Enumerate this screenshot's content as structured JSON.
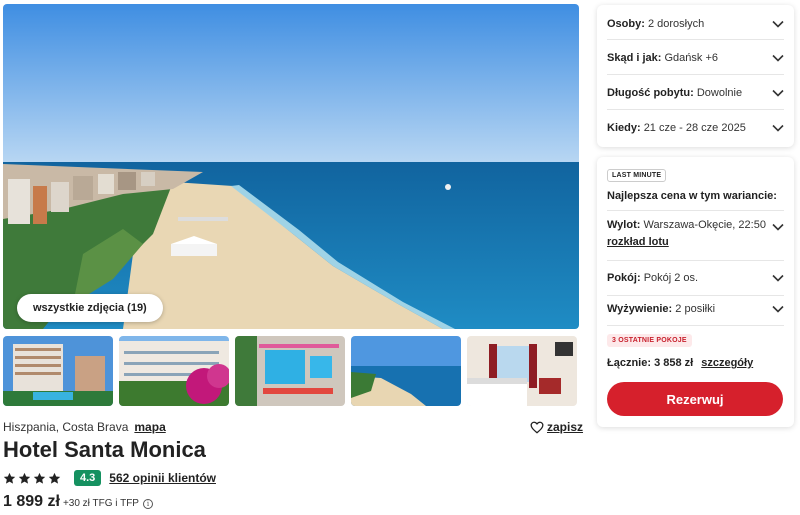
{
  "gallery": {
    "all_photos_label": "wszystkie zdjęcia (19)"
  },
  "hotel": {
    "location": "Hiszpania, Costa Brava",
    "map_link": "mapa",
    "save_label": "zapisz",
    "name": "Hotel Santa Monica",
    "stars": 4,
    "score": "4.3",
    "reviews_link": "562 opinii klientów",
    "price": "1 899 zł",
    "price_extra": "+30 zł TFG i TFP"
  },
  "search": {
    "travelers": {
      "label": "Osoby:",
      "value": "2 dorosłych"
    },
    "departure": {
      "label": "Skąd i jak:",
      "value": "Gdańsk +6"
    },
    "duration": {
      "label": "Długość pobytu:",
      "value": "Dowolnie"
    },
    "dates": {
      "label": "Kiedy:",
      "value": "21 cze - 28 cze 2025"
    }
  },
  "offer": {
    "badge": "LAST MINUTE",
    "best_price_label": "Najlepsza cena w tym wariancie:",
    "flight": {
      "label": "Wylot:",
      "value": "Warszawa-Okęcie, 22:50",
      "link": "rozkład lotu"
    },
    "room": {
      "label": "Pokój:",
      "value": "Pokój 2 os."
    },
    "board": {
      "label": "Wyżywienie:",
      "value": "2 posiłki"
    },
    "rooms_badge": "3 OSTATNIE POKOJE",
    "total_label": "Łącznie: 3 858 zł",
    "details_link": "szczegóły",
    "book_label": "Rezerwuj"
  },
  "colors": {
    "accent_red": "#d6202c",
    "score_green": "#159160",
    "sea": "#1a72b0",
    "sky": "#6da9e3"
  },
  "icons": [
    "chevron-down-icon",
    "heart-icon",
    "star-icon",
    "info-icon"
  ]
}
